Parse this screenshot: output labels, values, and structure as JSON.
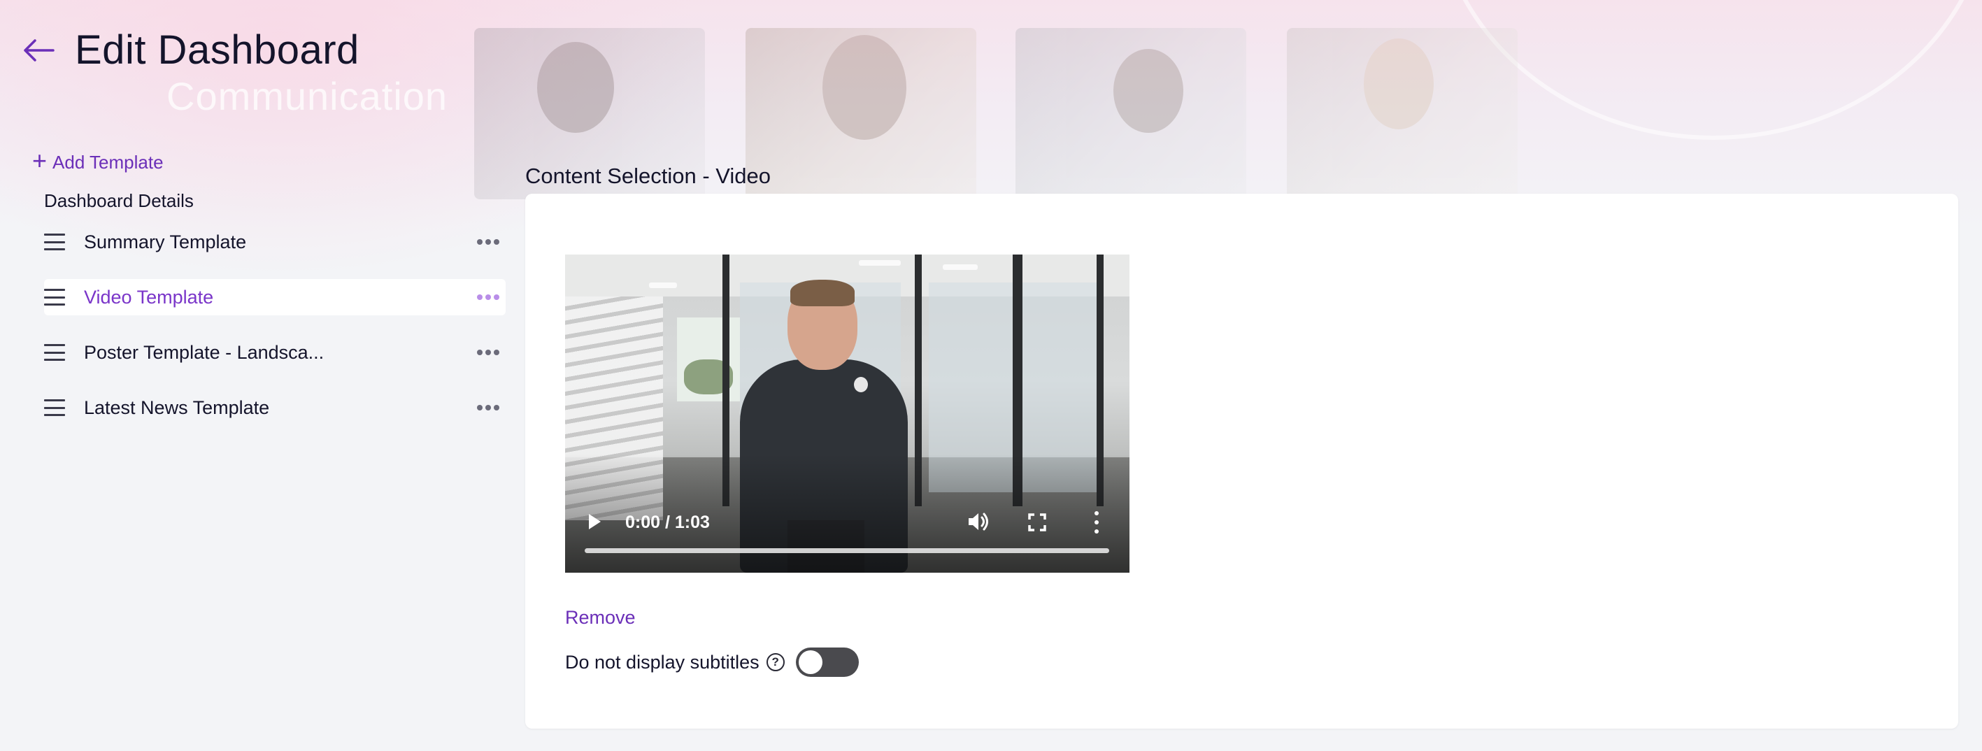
{
  "header": {
    "title": "Edit Dashboard",
    "banner_title": "Communication"
  },
  "sidebar": {
    "add_template_label": "Add Template",
    "details_heading": "Dashboard Details",
    "items": [
      {
        "label": "Summary Template",
        "active": false
      },
      {
        "label": "Video Template",
        "active": true
      },
      {
        "label": "Poster Template - Landsca...",
        "active": false
      },
      {
        "label": "Latest News Template",
        "active": false
      }
    ]
  },
  "content": {
    "section_title": "Content Selection - Video",
    "video": {
      "time": "0:00 / 1:03",
      "progress": 0
    },
    "remove_label": "Remove",
    "subtitles_label": "Do not display subtitles",
    "subtitles_toggle_on": false
  },
  "colors": {
    "accent": "#6b2fb8",
    "active_item": "#7a35c9",
    "background": "#f3f4f7",
    "card": "#ffffff",
    "toggle_off": "#4a4a4e"
  },
  "icons": {
    "back": "arrow-left-icon",
    "add": "plus-icon",
    "drag": "drag-handle-icon",
    "more": "more-horizontal-icon",
    "help": "help-circle-icon",
    "play": "play-icon",
    "volume": "volume-icon",
    "fullscreen": "fullscreen-icon",
    "video_menu": "more-vertical-icon"
  }
}
